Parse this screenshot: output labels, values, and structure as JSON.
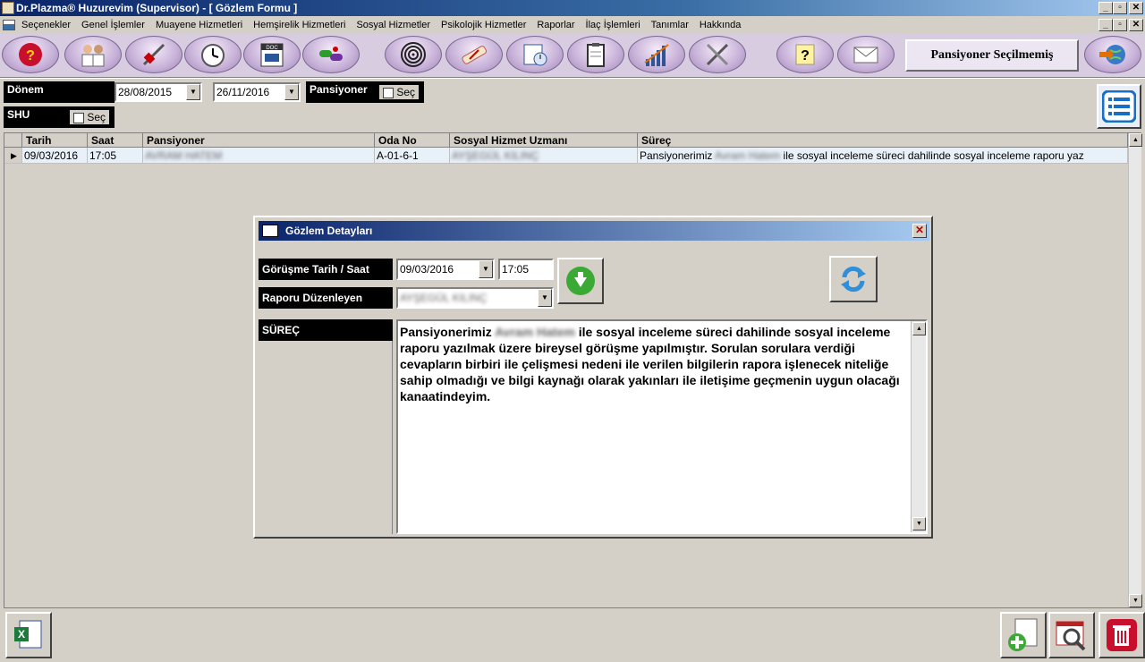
{
  "window": {
    "title": "Dr.Plazma® Huzurevim (Supervisor) - [ Gözlem Formu ]"
  },
  "menu": [
    "Seçenekler",
    "Genel İşlemler",
    "Muayene Hizmetleri",
    "Hemşirelik Hizmetleri",
    "Sosyal Hizmetler",
    "Psikolojik Hizmetler",
    "Raporlar",
    "İlaç İşlemleri",
    "Tanımlar",
    "Hakkında"
  ],
  "toolbar": {
    "status": "Pansiyoner Seçilmemiş",
    "doc_label": "DOC"
  },
  "filters": {
    "donem_label": "Dönem",
    "date_from": "28/08/2015",
    "date_to": "26/11/2016",
    "pansiyoner_label": "Pansiyoner",
    "sec_label": "Seç",
    "shu_label": "SHU"
  },
  "grid": {
    "headers": [
      "Tarih",
      "Saat",
      "Pansiyoner",
      "Oda No",
      "Sosyal Hizmet Uzmanı",
      "Süreç"
    ],
    "row": {
      "tarih": "09/03/2016",
      "saat": "17:05",
      "pansiyoner": "AVRAM HATEM",
      "oda": "A-01-6-1",
      "uzman": "AYŞEGÜL KILINÇ",
      "surec_prefix": "Pansiyonerimiz",
      "surec_name": "Avram Hatem",
      "surec_rest": "ile sosyal inceleme süreci dahilinde sosyal inceleme raporu yaz"
    }
  },
  "dialog": {
    "title": "Gözlem Detayları",
    "tarih_saat_label": "Görüşme Tarih / Saat",
    "tarih": "09/03/2016",
    "saat": "17:05",
    "duzenleyen_label": "Raporu Düzenleyen",
    "duzenleyen": "AYŞEGÜL KILINÇ",
    "surec_label": "SÜREÇ",
    "memo_prefix": "Pansiyonerimiz",
    "memo_name": "Avram Hatem",
    "memo_rest": "ile sosyal inceleme süreci dahilinde sosyal inceleme raporu yazılmak üzere bireysel görüşme yapılmıştır. Sorulan sorulara verdiği cevapların birbiri ile çelişmesi nedeni ile verilen bilgilerin rapora işlenecek niteliğe sahip olmadığı ve bilgi kaynağı olarak yakınları ile iletişime geçmenin uygun olacağı kanaatindeyim."
  },
  "colors": {
    "titlebar": "#0a246a",
    "toolbar_bg": "#d8cce0",
    "row_bg": "#e8f0f8",
    "label_bg": "#000000"
  }
}
